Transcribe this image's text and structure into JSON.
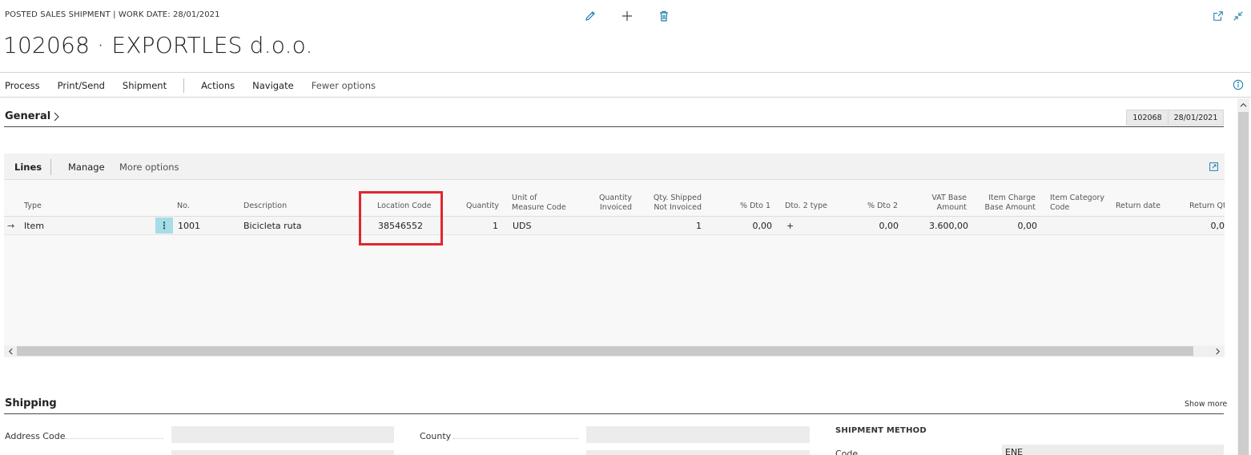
{
  "header": {
    "caption": "POSTED SALES SHIPMENT | WORK DATE: 28/01/2021",
    "title": "102068 · EXPORTLES d.o.o.",
    "icons": [
      "edit-icon",
      "new-icon",
      "delete-icon",
      "open-new-window-icon",
      "collapse-icon"
    ]
  },
  "actionbar": {
    "items": [
      "Process",
      "Print/Send",
      "Shipment",
      "Actions",
      "Navigate",
      "Fewer options"
    ]
  },
  "general": {
    "title": "General",
    "chips": [
      "102068",
      "28/01/2021"
    ]
  },
  "lines": {
    "toolbar": [
      "Lines",
      "Manage",
      "More options"
    ],
    "columns": {
      "type": "Type",
      "no": "No.",
      "description": "Description",
      "location_code": "Location Code",
      "quantity": "Quantity",
      "uom_1": "Unit of",
      "uom_2": "Measure Code",
      "qty_invoiced_1": "Quantity",
      "qty_invoiced_2": "Invoiced",
      "qty_shipped_1": "Qty. Shipped",
      "qty_shipped_2": "Not Invoiced",
      "dto1": "% Dto 1",
      "dto2_type": "Dto. 2 type",
      "dto2": "% Dto 2",
      "vat_1": "VAT Base",
      "vat_2": "Amount",
      "charge_1": "Item Charge",
      "charge_2": "Base Amount",
      "category_1": "Item Category",
      "category_2": "Code",
      "return_date": "Return date",
      "return_qty": "Return Qt"
    },
    "rows": [
      {
        "arrow": "→",
        "type": "Item",
        "dots": "⋮",
        "no": "1001",
        "description": "Bicicleta ruta",
        "location_code": "38546552",
        "quantity": "1",
        "uom": "UDS",
        "qty_shipped_not_invoiced": "1",
        "dto1": "0,00",
        "dto2_type": "+",
        "dto2": "0,00",
        "vat_base_amount": "3.600,00",
        "item_charge_base_amount": "0,00",
        "return_qty": "0,0"
      }
    ]
  },
  "shipping": {
    "title": "Shipping",
    "show_more": "Show more",
    "address_code_label": "Address Code",
    "county_label": "County",
    "shipment_method_caption": "SHIPMENT METHOD",
    "code_label": "Code",
    "code_value": "ENE"
  },
  "colors": {
    "accent": "#1b7fa8",
    "highlight": "#e0262f",
    "row_menu": "#a6dde6"
  }
}
